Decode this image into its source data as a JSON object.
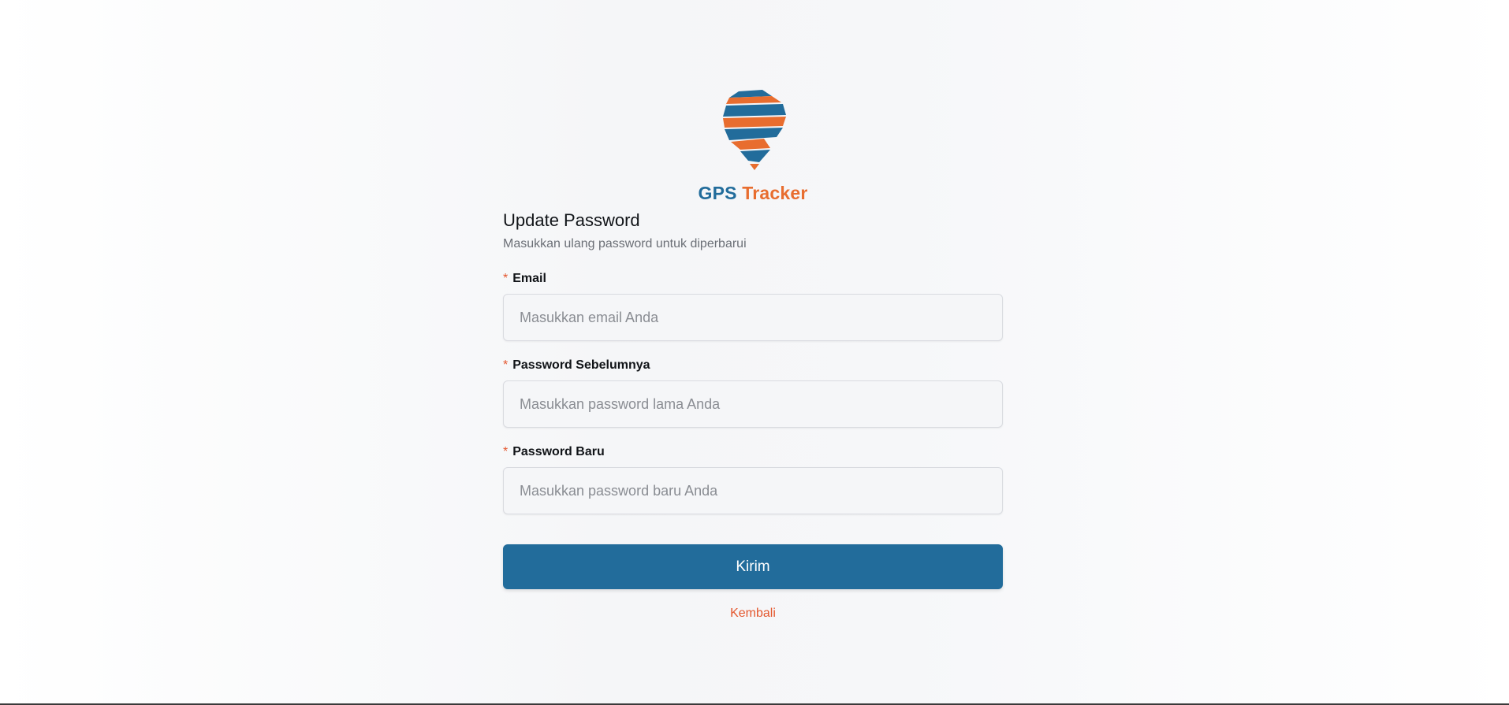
{
  "brand": {
    "logo_icon": "map-pin-logo-icon",
    "name_part1": "GPS",
    "name_part2": "Tracker",
    "colors": {
      "blue": "#226c9b",
      "orange": "#e86d2f"
    }
  },
  "form": {
    "title": "Update Password",
    "subtitle": "Masukkan ulang password untuk diperbarui",
    "required_marker": "*",
    "fields": [
      {
        "label": "Email",
        "placeholder": "Masukkan email Anda",
        "value": ""
      },
      {
        "label": "Password Sebelumnya",
        "placeholder": "Masukkan password lama Anda",
        "value": ""
      },
      {
        "label": "Password Baru",
        "placeholder": "Masukkan password baru Anda",
        "value": ""
      }
    ],
    "submit_label": "Kirim",
    "back_label": "Kembali"
  },
  "colors": {
    "primary": "#226c9b",
    "accent": "#e4572e"
  }
}
